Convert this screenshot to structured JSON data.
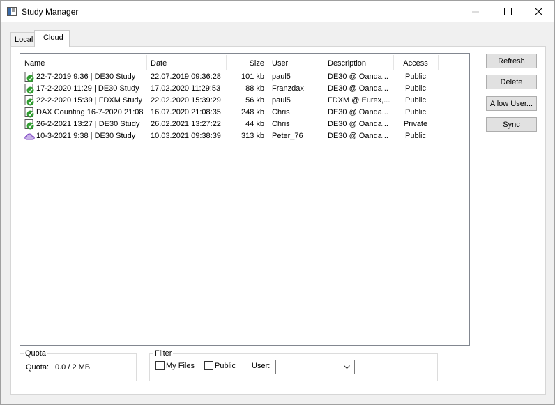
{
  "window": {
    "title": "Study Manager",
    "controls": {
      "minimize": "—",
      "maximize": "☐",
      "close": "✕"
    }
  },
  "tabs": [
    {
      "label": "Local",
      "selected": false
    },
    {
      "label": "Cloud",
      "selected": true
    }
  ],
  "list": {
    "columns": [
      "Name",
      "Date",
      "Size",
      "User",
      "Description",
      "Access"
    ],
    "rows": [
      {
        "icon": "check-badge-icon",
        "name": "22-7-2019 9:36 | DE30 Study",
        "date": "22.07.2019 09:36:28",
        "size": "101 kb",
        "user": "paul5",
        "description": "DE30 @ Oanda...",
        "access": "Public"
      },
      {
        "icon": "check-badge-icon",
        "name": "17-2-2020 11:29 | DE30 Study",
        "date": "17.02.2020 11:29:53",
        "size": "88 kb",
        "user": "Franzdax",
        "description": "DE30 @ Oanda...",
        "access": "Public"
      },
      {
        "icon": "check-badge-icon",
        "name": "22-2-2020 15:39 | FDXM Study",
        "date": "22.02.2020 15:39:29",
        "size": "56 kb",
        "user": "paul5",
        "description": "FDXM @ Eurex,...",
        "access": "Public"
      },
      {
        "icon": "check-badge-icon",
        "name": "DAX Counting 16-7-2020 21:08",
        "date": "16.07.2020 21:08:35",
        "size": "248 kb",
        "user": "Chris",
        "description": "DE30 @ Oanda...",
        "access": "Public"
      },
      {
        "icon": "check-badge-icon",
        "name": "26-2-2021 13:27 | DE30 Study",
        "date": "26.02.2021 13:27:22",
        "size": "44 kb",
        "user": "Chris",
        "description": "DE30 @ Oanda...",
        "access": "Private"
      },
      {
        "icon": "cloud-icon",
        "name": "10-3-2021 9:38 | DE30 Study",
        "date": "10.03.2021 09:38:39",
        "size": "313 kb",
        "user": "Peter_76",
        "description": "DE30 @ Oanda...",
        "access": "Public"
      }
    ]
  },
  "buttons": {
    "refresh": "Refresh",
    "delete": "Delete",
    "allow_user": "Allow User...",
    "sync": "Sync"
  },
  "quota": {
    "group_title": "Quota",
    "label": "Quota:",
    "value": "0.0 / 2 MB"
  },
  "filter": {
    "group_title": "Filter",
    "my_files_label": "My Files",
    "my_files_checked": false,
    "public_label": "Public",
    "public_checked": false,
    "user_label": "User:",
    "user_value": ""
  },
  "colors": {
    "check_icon_green": "#2e9b2e",
    "cloud_icon_purple": "#7a3fbf"
  }
}
